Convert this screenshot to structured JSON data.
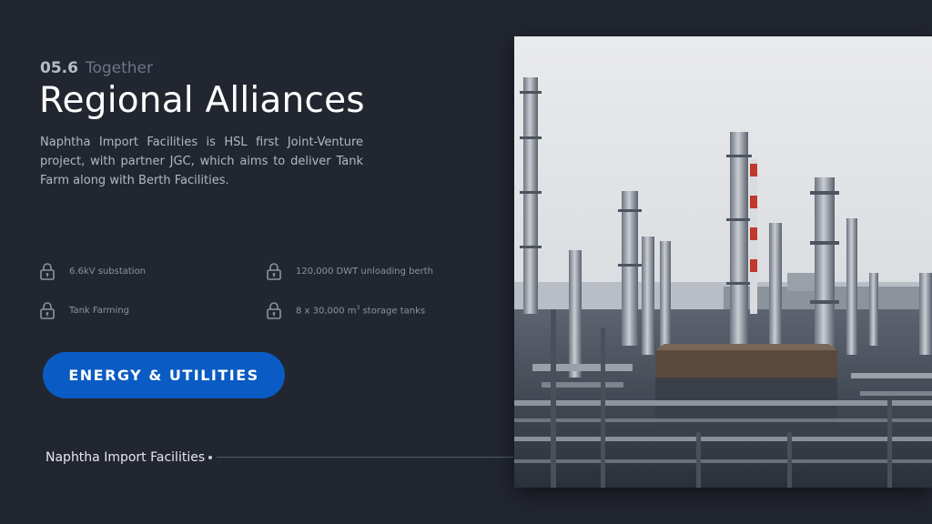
{
  "section": {
    "number": "05.6",
    "name": "Together"
  },
  "title": "Regional Alliances",
  "description": "Naphtha Import Facilities is HSL first Joint-Venture project, with partner JGC, which aims to deliver Tank Farm along with Berth Facilities.",
  "features": [
    {
      "text": "6.6kV substation",
      "icon": "lock-icon"
    },
    {
      "text": "120,000 DWT unloading berth",
      "icon": "lock-icon"
    },
    {
      "text": "Tank Farming",
      "icon": "lock-icon"
    },
    {
      "text_prefix": "8 x 30,000 m",
      "text_sup": "3",
      "text_suffix": " storage tanks",
      "icon": "lock-icon"
    }
  ],
  "cta": {
    "label": "ENERGY & UTILITIES"
  },
  "caption": "Naphtha Import Facilities",
  "colors": {
    "background": "#222630",
    "accent": "#0a5bc3",
    "muted_text": "#8c93a0"
  }
}
